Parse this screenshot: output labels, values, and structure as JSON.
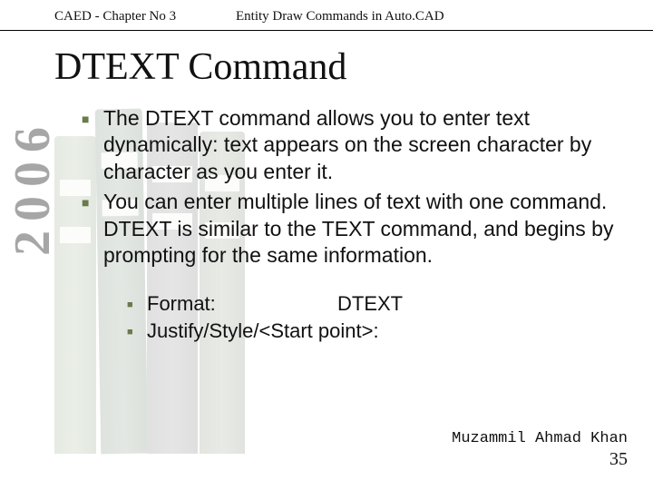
{
  "header": {
    "left": "CAED - Chapter No 3",
    "right": "Entity Draw Commands in Auto.CAD"
  },
  "title": "DTEXT Command",
  "year": "2006",
  "bullets": [
    "The DTEXT command allows you to enter text dynamically: text appears on the screen character by character as you enter it.",
    "You can enter multiple lines of text with one command. DTEXT is similar to the TEXT command, and begins by prompting for the same information."
  ],
  "sub": [
    {
      "label": "Format:",
      "value": "DTEXT"
    },
    {
      "label": "Justify/Style/<Start point>:",
      "value": ""
    }
  ],
  "footer": {
    "author": "Muzammil Ahmad Khan",
    "page": "35"
  }
}
